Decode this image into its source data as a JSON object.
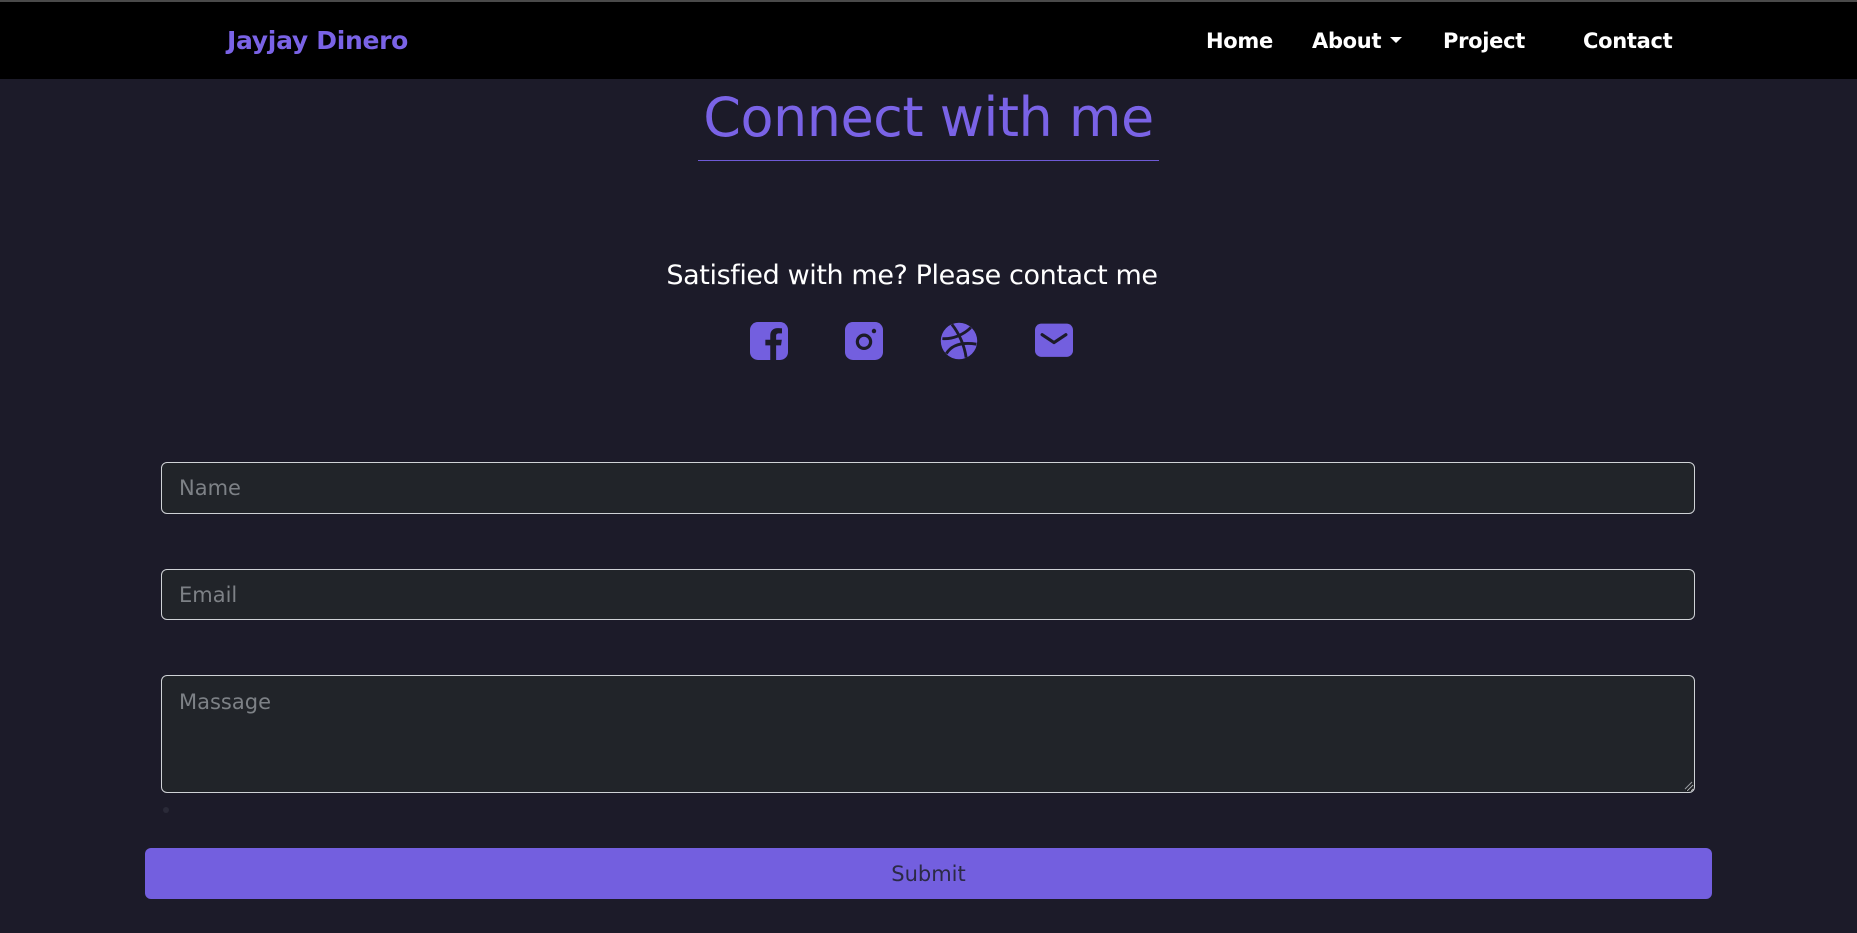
{
  "nav": {
    "brand": "Jayjay Dinero",
    "links": {
      "home": "Home",
      "about": "About",
      "project": "Project",
      "contact": "Contact"
    }
  },
  "main": {
    "heading": "Connect with me",
    "tagline": "Satisfied with me? Please contact me",
    "social_icons": [
      "facebook-icon",
      "instagram-icon",
      "dribbble-icon",
      "email-icon"
    ]
  },
  "form": {
    "name_placeholder": "Name",
    "email_placeholder": "Email",
    "message_placeholder": "Massage",
    "submit_label": "Submit"
  },
  "colors": {
    "accent": "#735fdf",
    "navbar": "#000000",
    "background": "#1c1b29",
    "field_bg": "#212429"
  }
}
